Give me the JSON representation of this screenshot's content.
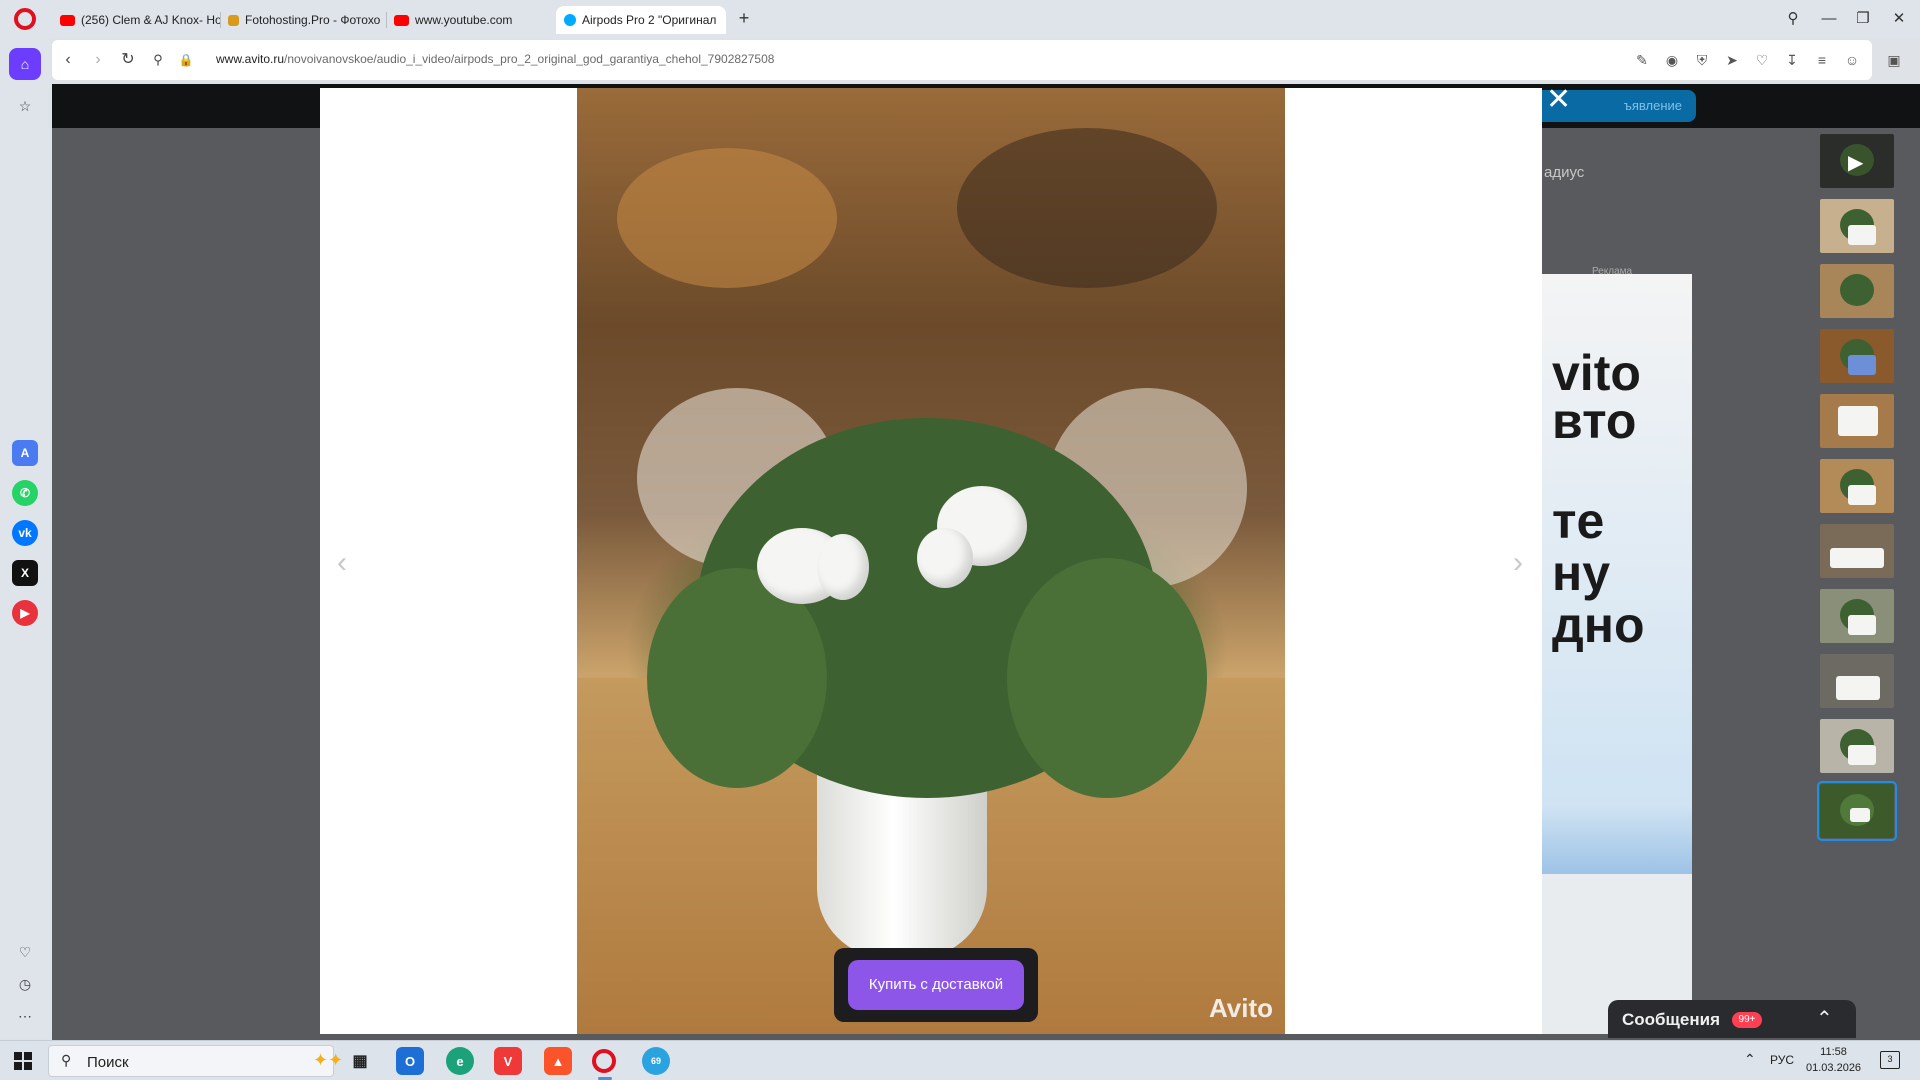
{
  "browser": {
    "tabs": [
      {
        "title": "(256) Clem & AJ Knox- Ho",
        "favicon": "youtube-icon",
        "color": "#ff0000"
      },
      {
        "title": "Fotohosting.Pro - Фотохо",
        "favicon": "fotohosting-icon",
        "color": "#d99a1b"
      },
      {
        "title": "www.youtube.com",
        "favicon": "youtube-icon",
        "color": "#ff0000"
      },
      {
        "title": "Airpods Pro 2 \"Оригинал",
        "favicon": "avito-icon",
        "color": "#00aaff"
      }
    ],
    "new_tab_label": "+",
    "url_host": "www.avito.ru",
    "url_path": "/novoivanovskoe/audio_i_video/airpods_pro_2_original_god_garantiya_chehol_7902827508"
  },
  "sidebar": {
    "apps": [
      "aria-icon",
      "whatsapp-icon",
      "vk-icon",
      "x-icon",
      "music-icon"
    ],
    "bottom": [
      "heart-icon",
      "history-icon",
      "more-icon"
    ]
  },
  "page": {
    "post_ad_button": "ъявление",
    "radius_text": "адиус",
    "ad_label": "Реклама",
    "ad_lines": [
      "vito",
      "вто",
      "те",
      "ну",
      "дно"
    ]
  },
  "gallery": {
    "watermark": "Avito",
    "buy_button": "Купить с доставкой",
    "prev_arrow": "‹",
    "next_arrow": "›",
    "close": "✕",
    "thumbnail_count": 11,
    "selected_thumbnail": 11
  },
  "messages": {
    "label": "Сообщения",
    "badge": "99+"
  },
  "taskbar": {
    "search_placeholder": "Поиск",
    "language": "РУС",
    "time": "11:58",
    "date": "01.03.2026",
    "notification_count": "3",
    "telegram_badge": "69"
  }
}
